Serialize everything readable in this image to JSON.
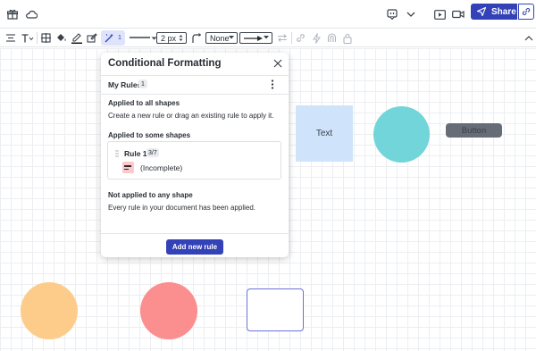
{
  "header": {
    "share_label": "Share"
  },
  "toolbar": {
    "active_count": "1",
    "stroke_width": "2 px",
    "arrow_start": "None"
  },
  "canvas": {
    "text_shape_label": "Text",
    "button_shape_label": "Button",
    "colors": {
      "text_shape": "#cfe4fb",
      "teal_circle": "#72d5d9",
      "button_shape": "#676d77",
      "orange_circle": "#fecc8a",
      "red_circle": "#fb8e8e",
      "outline_rect": "#6a72d9"
    }
  },
  "panel": {
    "title": "Conditional Formatting",
    "my_rules_label": "My Rules",
    "my_rules_count": "1",
    "applied_all_title": "Applied to all shapes",
    "applied_all_text": "Create a new rule or drag an existing rule to apply it.",
    "applied_some_title": "Applied to some shapes",
    "rule": {
      "name": "Rule 1",
      "badge": "3/7",
      "status": "(Incomplete)"
    },
    "not_applied_title": "Not applied to any shape",
    "not_applied_text": "Every rule in your document has been applied.",
    "add_rule_label": "Add new rule"
  },
  "accent_color": "#3342b6"
}
